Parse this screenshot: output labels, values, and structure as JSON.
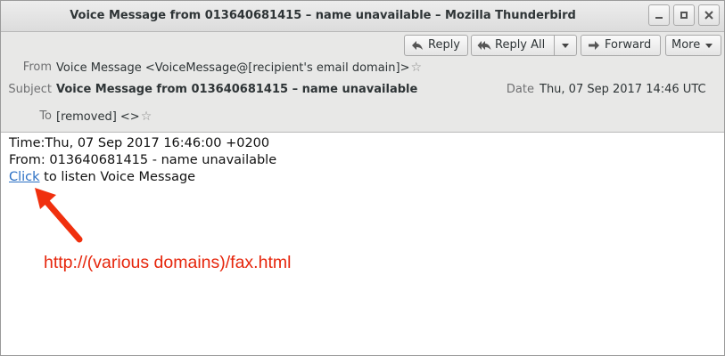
{
  "window": {
    "title": "Voice Message from 013640681415 – name unavailable – Mozilla Thunderbird",
    "controls": [
      "minimize-icon",
      "maximize-icon",
      "close-icon"
    ]
  },
  "toolbar": {
    "reply_label": "Reply",
    "reply_all_label": "Reply All",
    "forward_label": "Forward",
    "more_label": "More"
  },
  "headers": {
    "from_label": "From",
    "from_value": "Voice Message <VoiceMessage@[recipient's email domain]>",
    "subject_label": "Subject",
    "subject_value": "Voice Message from 013640681415 – name unavailable",
    "date_label": "Date",
    "date_value": "Thu, 07 Sep 2017 14:46 UTC",
    "to_label": "To",
    "to_value": "[removed] <>"
  },
  "body": {
    "line1": "Time:Thu, 07 Sep 2017 16:46:00 +0200",
    "line2": "From: 013640681415 - name unavailable",
    "link_text": "Click",
    "line3_rest": " to listen Voice Message"
  },
  "annotation": {
    "text": "http://(various domains)/fax.html",
    "color": "#e6260c"
  },
  "colors": {
    "link": "#2a6fc4",
    "header_bg": "#e8e8e7"
  }
}
